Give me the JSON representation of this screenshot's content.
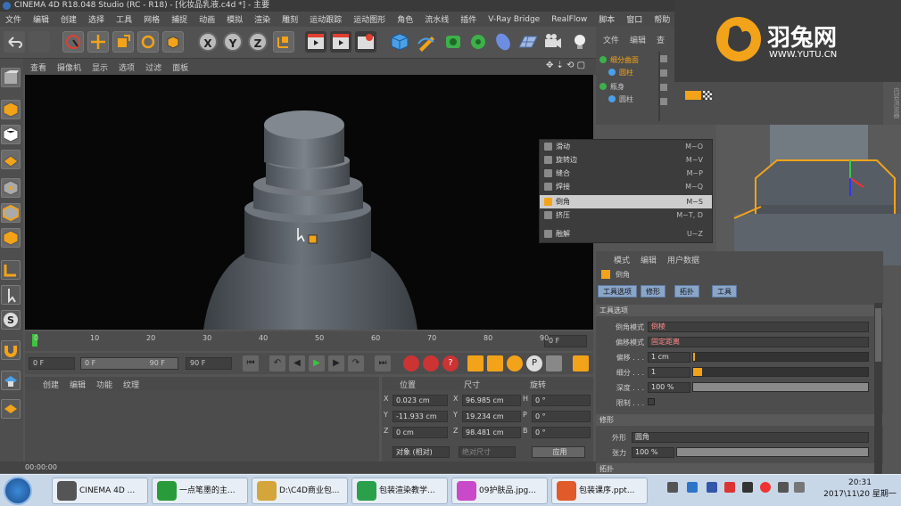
{
  "window": {
    "title": "CINEMA 4D R18.048 Studio (RC - R18) - [化妆品乳液.c4d *] - 主要"
  },
  "menubar": [
    "文件",
    "编辑",
    "创建",
    "选择",
    "工具",
    "网格",
    "捕捉",
    "动画",
    "模拟",
    "渲染",
    "雕刻",
    "运动跟踪",
    "运动图形",
    "角色",
    "流水线",
    "插件",
    "V-Ray Bridge",
    "RealFlow",
    "脚本",
    "窗口",
    "帮助"
  ],
  "toolbar": {
    "x": "X",
    "y": "Y",
    "z": "Z"
  },
  "viewport_menu": [
    "查看",
    "摄像机",
    "显示",
    "选项",
    "过滤",
    "面板"
  ],
  "timeline": {
    "ticks": [
      "0",
      "10",
      "20",
      "30",
      "40",
      "50",
      "60",
      "70",
      "80",
      "90"
    ],
    "current_frame": "0 F"
  },
  "playback": {
    "start": "0 F",
    "range_start": "0 F",
    "range_end": "90 F",
    "end": "90 F"
  },
  "material_menu": [
    "创建",
    "编辑",
    "功能",
    "纹理"
  ],
  "coords": {
    "headers": [
      "位置",
      "尺寸",
      "旋转"
    ],
    "rows": [
      {
        "axis": "X",
        "pos": "0.023 cm",
        "size_axis": "X",
        "size": "96.985 cm",
        "rot_axis": "H",
        "rot": "0 °"
      },
      {
        "axis": "Y",
        "pos": "-11.933 cm",
        "size_axis": "Y",
        "size": "19.234 cm",
        "rot_axis": "P",
        "rot": "0 °"
      },
      {
        "axis": "Z",
        "pos": "0 cm",
        "size_axis": "Z",
        "size": "98.481 cm",
        "rot_axis": "B",
        "rot": "0 °"
      }
    ],
    "mode": "对象 (相对)",
    "size_mode": "绝对尺寸",
    "apply": "应用"
  },
  "status": "00:00:00",
  "object_manager": {
    "tabs": [
      "文件",
      "编辑",
      "查"
    ],
    "objects": [
      {
        "name": "细分曲面",
        "sel": true
      },
      {
        "name": "圆柱",
        "sel": true
      },
      {
        "name": "瓶身",
        "sel": false
      },
      {
        "name": "圆柱",
        "sel": false
      }
    ],
    "side": "内容浏览器"
  },
  "context_menu": [
    {
      "label": "滑动",
      "key": "M~O",
      "sel": false
    },
    {
      "label": "旋转边",
      "key": "M~V",
      "sel": false
    },
    {
      "label": "缝合",
      "key": "M~P",
      "sel": false
    },
    {
      "label": "焊接",
      "key": "M~Q",
      "sel": false
    },
    {
      "label": "倒角",
      "key": "M~S",
      "sel": true
    },
    {
      "label": "挤压",
      "key": "M~T, D",
      "sel": false
    },
    {
      "label": "融解",
      "key": "U~Z",
      "sel": false
    }
  ],
  "attributes": {
    "menu": [
      "模式",
      "编辑",
      "用户数据"
    ],
    "tool": "倒角",
    "tabs": [
      "工具选项",
      "修形",
      "拓扑",
      "工具"
    ],
    "section1": "工具选项",
    "fields": [
      {
        "label": "倒角模式",
        "value": "倒棱"
      },
      {
        "label": "偏移模式",
        "value": "固定距离"
      },
      {
        "label": "偏移 . . .",
        "value": "1 cm"
      },
      {
        "label": "细分 . . .",
        "value": "1"
      },
      {
        "label": "深度 . . .",
        "value": "100 %"
      },
      {
        "label": "限制 . . .",
        "value": ""
      }
    ],
    "section2": "修形",
    "shape_label": "外形",
    "shape_value": "圆角",
    "tension_label": "张力",
    "tension_value": "100 %",
    "section3": "拓扑"
  },
  "watermark": {
    "brand": "羽兔网",
    "url": "WWW.YUTU.CN"
  },
  "taskbar": {
    "tasks": [
      "CINEMA 4D ...",
      "一点笔墨的主...",
      "D:\\C4D商业包...",
      "包装渲染教学...",
      "09护肤品.jpg...",
      "包装课序.ppt..."
    ],
    "time": "20:31",
    "date": "2017\\11\\20 星期一"
  },
  "colors": {
    "accent_orange": "#f2a31a",
    "selection_blue": "#8aa5c8",
    "viewport_bg": "#070707"
  }
}
